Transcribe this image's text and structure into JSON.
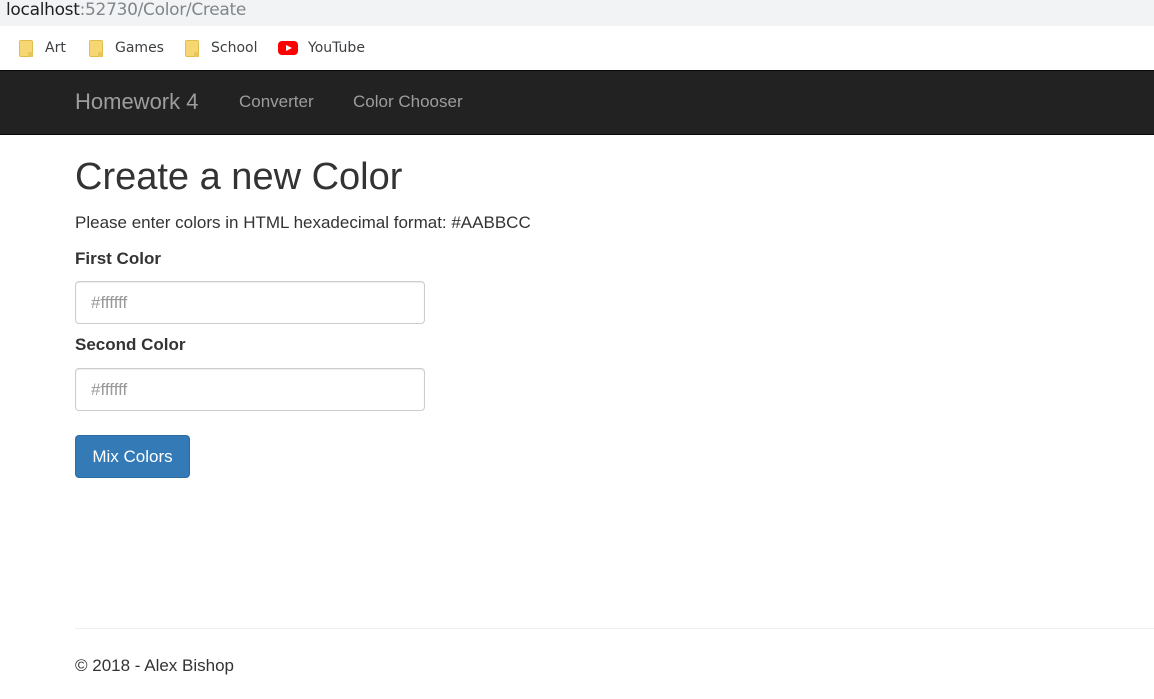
{
  "browser": {
    "url_host": "localhost",
    "url_path": ":52730/Color/Create",
    "bookmarks": [
      {
        "label": "Art",
        "icon": "folder-icon"
      },
      {
        "label": "Games",
        "icon": "folder-icon"
      },
      {
        "label": "School",
        "icon": "folder-icon"
      },
      {
        "label": "YouTube",
        "icon": "youtube-icon"
      }
    ]
  },
  "navbar": {
    "brand": "Homework 4",
    "links": [
      {
        "label": "Converter"
      },
      {
        "label": "Color Chooser"
      }
    ],
    "background": "#222222",
    "link_color": "#9d9d9d"
  },
  "main": {
    "title": "Create a new Color",
    "instructions": "Please enter colors in HTML hexadecimal format: #AABBCC",
    "first_color": {
      "label": "First Color",
      "value": "",
      "placeholder": "#ffffff"
    },
    "second_color": {
      "label": "Second Color",
      "value": "",
      "placeholder": "#ffffff"
    },
    "submit_label": "Mix Colors",
    "button_color": "#337ab7"
  },
  "footer": {
    "text": "© 2018 - Alex Bishop"
  }
}
